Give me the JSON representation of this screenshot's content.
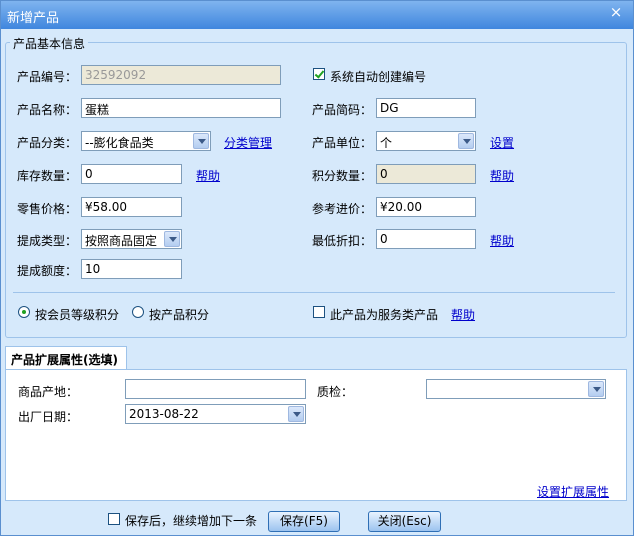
{
  "window": {
    "title": "新增产品",
    "close_icon": "×"
  },
  "basic": {
    "legend": "产品基本信息",
    "code": {
      "label": "产品编号：",
      "value": "32592092"
    },
    "auto_code": {
      "label": "系统自动创建编号",
      "checked": true
    },
    "name": {
      "label": "产品名称：",
      "value": "蛋糕"
    },
    "short_code": {
      "label": "产品简码：",
      "value": "DG"
    },
    "category": {
      "label": "产品分类：",
      "value": "--膨化食品类",
      "link": "分类管理"
    },
    "unit": {
      "label": "产品单位：",
      "value": "个",
      "link": "设置"
    },
    "stock": {
      "label": "库存数量：",
      "value": "0",
      "link": "帮助"
    },
    "points": {
      "label": "积分数量：",
      "value": "0",
      "link": "帮助"
    },
    "retail_price": {
      "label": "零售价格：",
      "value": "¥58.00"
    },
    "ref_price": {
      "label": "参考进价：",
      "value": "¥20.00"
    },
    "commission_type": {
      "label": "提成类型：",
      "value": "按照商品固定比"
    },
    "min_discount": {
      "label": "最低折扣：",
      "value": "0",
      "link": "帮助"
    },
    "commission_amount": {
      "label": "提成额度：",
      "value": "10"
    },
    "radio_member": {
      "label": "按会员等级积分",
      "checked": true
    },
    "radio_product": {
      "label": "按产品积分",
      "checked": false
    },
    "service_product": {
      "label": "此产品为服务类产品",
      "checked": false,
      "link": "帮助"
    }
  },
  "ext": {
    "tab_label": "产品扩展属性(选填)",
    "origin": {
      "label": "商品产地：",
      "value": ""
    },
    "quality": {
      "label": "质检：",
      "value": ""
    },
    "factory_date": {
      "label": "出厂日期：",
      "value": "2013-08-22"
    },
    "settings_link": "设置扩展属性"
  },
  "footer": {
    "continue_label": "保存后，继续增加下一条",
    "continue_checked": false,
    "save_label": "保存(F5)",
    "close_label": "关闭(Esc)"
  }
}
